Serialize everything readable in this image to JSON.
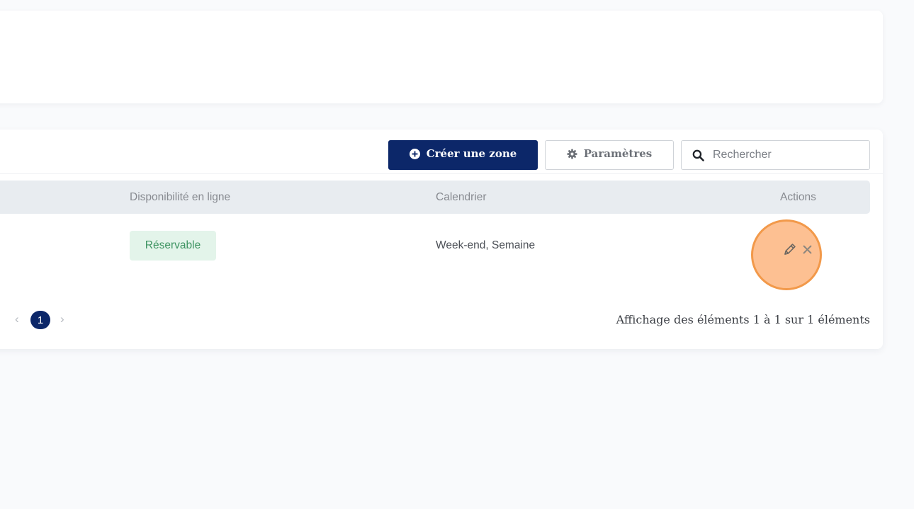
{
  "toolbar": {
    "create_label": "Créer une zone",
    "settings_label": "Paramètres",
    "search_placeholder": "Rechercher"
  },
  "table": {
    "columns": {
      "online": "Disponibilité en ligne",
      "calendar": "Calendrier",
      "actions": "Actions"
    },
    "rows": [
      {
        "online": "Réservable",
        "calendar": "Week-end, Semaine"
      }
    ]
  },
  "pagination": {
    "prev": "‹",
    "current": "1",
    "next": "›",
    "info": "Affichage des éléments 1 à 1 sur 1 éléments"
  },
  "icons": {
    "create": "plus-circle-icon",
    "settings": "gear-icon",
    "search": "search-icon",
    "edit": "pencil-icon",
    "delete": "close-icon"
  },
  "colors": {
    "primary": "#0c2769",
    "badge_bg": "#e3f4ea",
    "badge_text": "#3e9462",
    "header_bg": "#e8ecf0",
    "highlight": "#f2994a"
  }
}
